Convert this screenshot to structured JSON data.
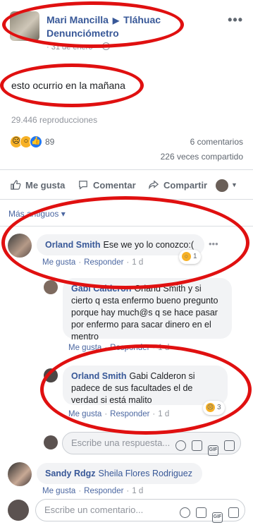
{
  "post": {
    "author": "Mari Mancilla",
    "arrow": "▶",
    "group": "Tláhuac Denunciómetro",
    "date": "31 de enero",
    "more": "•••",
    "text": "esto ocurrio en la mañana",
    "views": "29.446 reproducciones",
    "reaction_count": "89",
    "comments_count": "6 comentarios",
    "shares_count": "226 veces compartido"
  },
  "actions": {
    "like": "Me gusta",
    "comment": "Comentar",
    "share": "Compartir"
  },
  "sort_label": "Más antiguos ▾",
  "comments": [
    {
      "author": "Orland Smith",
      "text": "Ese we yo lo conozco:(",
      "like": "Me gusta",
      "reply": "Responder",
      "time": "1 d",
      "reaction_count": "1"
    },
    {
      "author": "Gabi Calderon",
      "text": "Orland Smith y si cierto q esta enfermo bueno pregunto porque hay much@s q se hace pasar por enfermo para sacar dinero en el mentro",
      "like": "Me gusta",
      "reply": "Responder",
      "time": "1 d"
    },
    {
      "author": "Orland Smith",
      "text": "Gabi Calderon si padece de sus facultades el de verdad si está malito",
      "like": "Me gusta",
      "reply": "Responder",
      "time": "1 d",
      "reaction_count": "3"
    },
    {
      "author": "Sandy Rdgz",
      "text": "Sheila Flores Rodriguez",
      "like": "Me gusta",
      "reply": "Responder",
      "time": "1 d"
    }
  ],
  "reply_placeholder": "Escribe una respuesta...",
  "comment_placeholder": "Escribe un comentario...",
  "colors": {
    "link": "#385898",
    "annotation": "#e01010",
    "like_blue": "#2078f4",
    "emoji_yellow": "#f7b125"
  }
}
